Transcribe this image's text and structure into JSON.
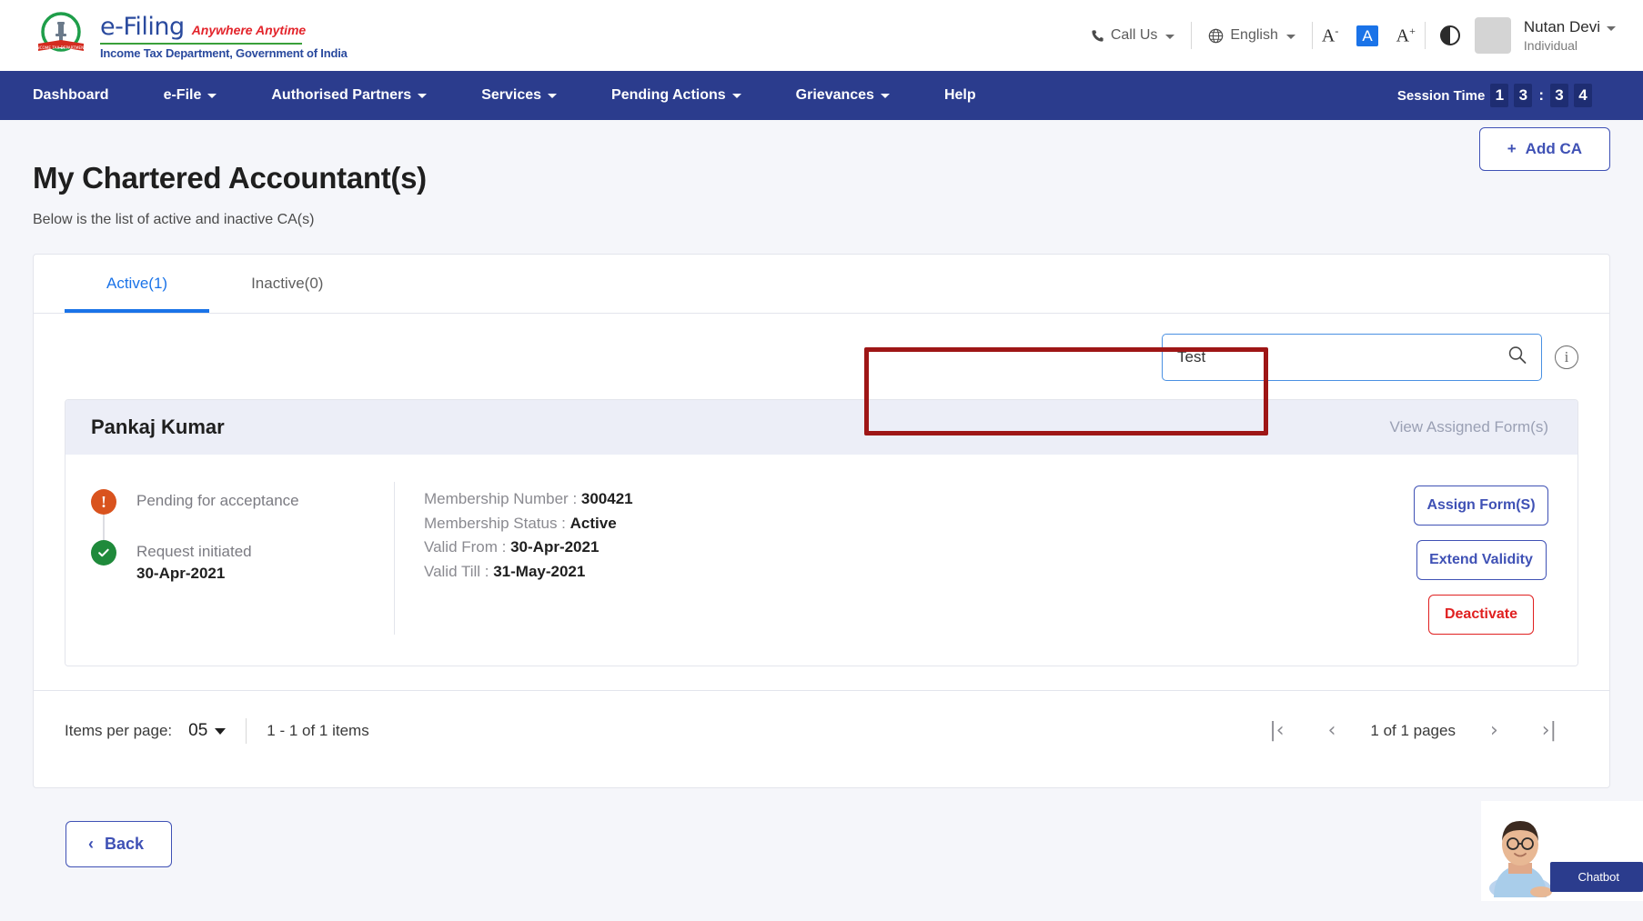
{
  "header": {
    "brand": {
      "title": "e-Filing",
      "tagline": "Anywhere Anytime",
      "subtitle": "Income Tax Department, Government of India"
    },
    "call_us": "Call Us",
    "language": "English",
    "font_decrease": "A",
    "font_normal": "A",
    "font_increase": "A",
    "user_name": "Nutan Devi",
    "user_role": "Individual"
  },
  "nav": {
    "items": [
      {
        "label": "Dashboard",
        "has_caret": false
      },
      {
        "label": "e-File",
        "has_caret": true
      },
      {
        "label": "Authorised Partners",
        "has_caret": true
      },
      {
        "label": "Services",
        "has_caret": true
      },
      {
        "label": "Pending Actions",
        "has_caret": true
      },
      {
        "label": "Grievances",
        "has_caret": true
      },
      {
        "label": "Help",
        "has_caret": false
      }
    ],
    "session_label": "Session Time",
    "session_digits": [
      "1",
      "3",
      "3",
      "4"
    ],
    "session_colon": ":"
  },
  "page": {
    "title": "My Chartered Accountant(s)",
    "subtitle": "Below is the list of active and inactive CA(s)",
    "add_ca_button": "Add CA",
    "add_ca_plus": "+"
  },
  "tabs": [
    {
      "label": "Active(1)",
      "active": true
    },
    {
      "label": "Inactive(0)",
      "active": false
    }
  ],
  "search": {
    "value": "Test",
    "placeholder": "Search",
    "info_glyph": "i"
  },
  "ca_card": {
    "name": "Pankaj Kumar",
    "view_forms_link": "View Assigned Form(s)",
    "timeline": [
      {
        "label": "Pending for acceptance",
        "date": "",
        "state": "warn",
        "glyph": "!"
      },
      {
        "label": "Request initiated",
        "date": "30-Apr-2021",
        "state": "ok",
        "glyph": "✓"
      }
    ],
    "details": [
      {
        "label": "Membership Number : ",
        "value": "300421"
      },
      {
        "label": "Membership Status : ",
        "value": "Active"
      },
      {
        "label": "Valid From : ",
        "value": "30-Apr-2021"
      },
      {
        "label": "Valid Till : ",
        "value": "31-May-2021"
      }
    ],
    "actions": [
      {
        "label": "Assign Form(S)",
        "style": "outline"
      },
      {
        "label": "Extend Validity",
        "style": "outline"
      },
      {
        "label": "Deactivate",
        "style": "danger"
      }
    ]
  },
  "pagination": {
    "items_per_page_label": "Items per page:",
    "items_per_page_value": "05",
    "range_text": "1 - 1 of 1 items",
    "first_glyph": "|‹",
    "prev_glyph": "‹",
    "pages_text": "1 of 1 pages",
    "next_glyph": "›",
    "last_glyph": "›|"
  },
  "footer": {
    "back_button": "Back",
    "back_glyph": "‹"
  },
  "chatbot": {
    "label": "Chatbot"
  },
  "colors": {
    "nav_blue": "#2b3c8d",
    "accent_blue": "#3f51b5",
    "link_blue": "#1a73e8",
    "danger_red": "#e02020",
    "annotation_red": "#9e1616",
    "warn_orange": "#d9531e",
    "success_green": "#1f8a3b",
    "page_bg": "#f5f6fa"
  }
}
